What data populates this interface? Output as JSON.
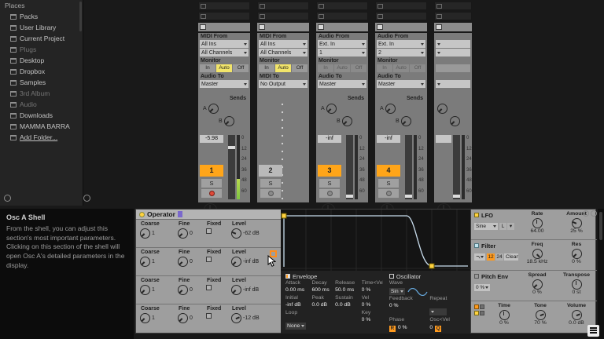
{
  "browser": {
    "header": "Places",
    "items": [
      {
        "label": "Packs",
        "icon": "packs-icon"
      },
      {
        "label": "User Library",
        "icon": "library-icon"
      },
      {
        "label": "Current Project",
        "icon": "folder-icon"
      },
      {
        "label": "Plugs",
        "icon": "plug-icon",
        "cls": "dim"
      },
      {
        "label": "Desktop",
        "icon": "folder-icon"
      },
      {
        "label": "Dropbox",
        "icon": "folder-icon"
      },
      {
        "label": "Samples",
        "icon": "folder-icon"
      },
      {
        "label": "3rd Album",
        "icon": "folder-icon",
        "cls": "dim"
      },
      {
        "label": "Audio",
        "icon": "folder-icon",
        "cls": "dim"
      },
      {
        "label": "Downloads",
        "icon": "folder-icon"
      },
      {
        "label": "MAMMA BARRA",
        "icon": "folder-icon"
      },
      {
        "label": "Add Folder...",
        "icon": "add-folder-icon",
        "cls": "underline"
      }
    ]
  },
  "mixer": {
    "monitor": {
      "label": "Monitor",
      "in": "In",
      "auto": "Auto",
      "off": "Off"
    },
    "sends_label": "Sends",
    "send_a": "A",
    "send_b": "B",
    "solo": "S",
    "scale": [
      "0",
      "12",
      "24",
      "36",
      "48",
      "60"
    ],
    "tracks": [
      {
        "num": "1",
        "in_label": "MIDI From",
        "input": "All Ins",
        "channel": "All Channels",
        "out_label": "Audio To",
        "output": "Master",
        "volume": "-5.98"
      },
      {
        "num": "2",
        "in_label": "MIDI From",
        "input": "All Ins",
        "channel": "All Channels",
        "out_label": "MIDI To",
        "output": "No Output"
      },
      {
        "num": "3",
        "in_label": "Audio From",
        "input": "Ext. In",
        "channel": "1",
        "out_label": "Audio To",
        "output": "Master",
        "volume": "-inf"
      },
      {
        "num": "4",
        "in_label": "Audio From",
        "input": "Ext. In",
        "channel": "2",
        "out_label": "Audio To",
        "output": "Master",
        "volume": "-inf"
      }
    ]
  },
  "info_panel": {
    "title": "Osc A Shell",
    "body": "From the shell, you can adjust this section's most important parameters. Clicking on this section of the shell will open Osc A's detailed parameters in the display."
  },
  "operator": {
    "title": "Operator",
    "shell_labels": {
      "coarse": "Coarse",
      "fine": "Fine",
      "fixed": "Fixed",
      "level": "Level"
    },
    "oscillators": [
      {
        "coarse": "1",
        "fine": "0",
        "level": "-62 dB"
      },
      {
        "coarse": "1",
        "fine": "0",
        "level": "-inf dB"
      },
      {
        "coarse": "1",
        "fine": "0",
        "level": "-inf dB"
      },
      {
        "coarse": "1",
        "fine": "0",
        "level": "-12 dB"
      }
    ],
    "envelope": {
      "header": "Envelope",
      "r1_labels": [
        "Attack",
        "Decay",
        "Release",
        "Time<Vel"
      ],
      "r1_values": [
        "0.00 ms",
        "600 ms",
        "50.0 ms",
        "0 %"
      ],
      "r2_labels": [
        "Initial",
        "Peak",
        "Sustain",
        "Vel"
      ],
      "r2_values": [
        "-inf dB",
        "0.0 dB",
        "0.0 dB",
        "0 %"
      ],
      "loop_label": "Loop",
      "loop": "None",
      "key_label": "Key",
      "key": "0 %"
    },
    "oscillator": {
      "header": "Oscillator",
      "wave_label": "Wave",
      "wave": "Sin",
      "feedback_label": "Feedback",
      "feedback": "0 %",
      "repeat_label": "Repeat",
      "phase_label": "Phase",
      "phase_retrig": "R",
      "phase": "0 %",
      "oscvel_label": "Osc<Vel",
      "oscvel": "0",
      "oscvel_q": "Q"
    },
    "lfo": {
      "label": "LFO",
      "wave": "Sine",
      "range": "L",
      "rate_label": "Rate",
      "rate": "64.00",
      "amount_label": "Amount",
      "amount": "25 %"
    },
    "filter": {
      "label": "Filter",
      "slope_12": "12",
      "slope_24": "24",
      "circuit": "Clean",
      "freq_label": "Freq",
      "freq": "18.5 kHz",
      "res_label": "Res",
      "res": "0 %"
    },
    "pitch": {
      "label": "Pitch Env",
      "amount": "0 %",
      "spread_label": "Spread",
      "spread": "0 %",
      "transpose_label": "Transpose",
      "transpose": "0 st"
    },
    "global": {
      "time_label": "Time",
      "time": "0 %",
      "tone_label": "Tone",
      "tone": "70 %",
      "volume_label": "Volume",
      "volume": "0.0 dB"
    }
  }
}
